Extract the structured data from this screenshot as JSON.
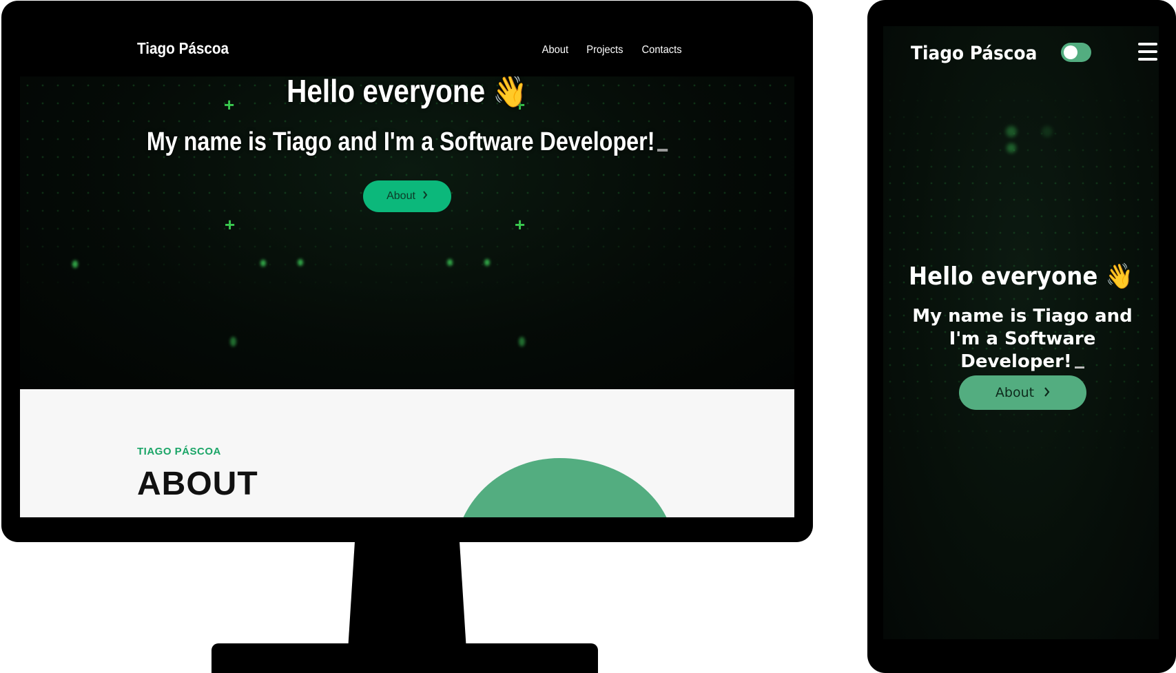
{
  "desktop": {
    "nav": {
      "brand": "Tiago Páscoa",
      "links": [
        "About",
        "Projects",
        "Contacts"
      ]
    },
    "hero": {
      "greeting": "Hello everyone",
      "greeting_emoji": "👋",
      "subtitle": "My name is Tiago and I'm a Software Developer!",
      "button_label": "About",
      "button_icon": "chevron-right-icon"
    },
    "about": {
      "kicker": "TIAGO PÁSCOA",
      "title": "ABOUT"
    }
  },
  "mobile": {
    "nav": {
      "brand": "Tiago Páscoa",
      "theme_toggle": "on",
      "menu_icon": "hamburger-menu-icon"
    },
    "hero": {
      "greeting": "Hello everyone",
      "greeting_emoji": "👋",
      "subtitle": "My name is Tiago and I'm a Software Developer!",
      "button_label": "About",
      "button_icon": "chevron-right-icon"
    }
  },
  "colors": {
    "accent_green": "#0cb87b",
    "soft_green": "#53ad80",
    "kicker_green": "#1ba567",
    "background_dark": "#050b07"
  }
}
